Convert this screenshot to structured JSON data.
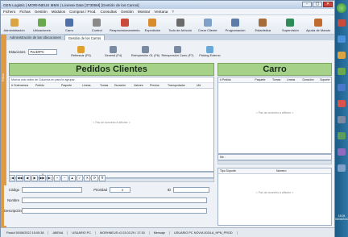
{
  "window": {
    "title": "GEN Logistic | MORHNEUS MMS | License Date [37306M] [Gestión de los Carros]",
    "controls": [
      "-",
      "▢",
      "✕"
    ]
  },
  "menu": [
    "Fichero",
    "Fichas",
    "Gestión",
    "Módulos",
    "Compras / Prod.",
    "Consultas",
    "Gestión",
    "Mostrar",
    "Ventana",
    "?"
  ],
  "toolbar": [
    {
      "label": "Administración",
      "icon": "pencil-icon",
      "color": "#d9a441"
    },
    {
      "label": "Ubicaciones",
      "icon": "box-icon",
      "color": "#6aa84f"
    },
    {
      "label": "Carro",
      "icon": "cart-icon",
      "color": "#4f6fa8"
    },
    {
      "label": "Control",
      "icon": "truck-icon",
      "color": "#8a8a8a"
    },
    {
      "label": "Reaprovisionamiento",
      "icon": "person-icon",
      "color": "#c94b3c"
    },
    {
      "label": "Expedición",
      "icon": "cube-icon",
      "color": "#d98b2b"
    },
    {
      "label": "Todo de Artículo",
      "icon": "gear-icon",
      "color": "#6b6b6b"
    },
    {
      "label": "Crear Cliente",
      "icon": "diamond-icon",
      "color": "#7fa0c8"
    },
    {
      "label": "Programación",
      "icon": "grid-icon",
      "color": "#5c7da8"
    },
    {
      "label": "Estadística",
      "icon": "chart-icon",
      "color": "#a86c3b"
    },
    {
      "label": "Supervisión",
      "icon": "monitor-icon",
      "color": "#2e8b57"
    },
    {
      "label": "Ayuda de Mando",
      "icon": "help-icon",
      "color": "#c06c2e"
    }
  ],
  "tabs": [
    "Administración de las Ubicaciones",
    "Gestión de los Carros"
  ],
  "side_label": "Filtros",
  "filter": {
    "label": "Estaciones",
    "value": "Pack#PC",
    "buttons": [
      {
        "label": "Refrescar (F5)",
        "icon": "refresh-icon",
        "color": "#e0a030"
      },
      {
        "label": "General (F4)",
        "icon": "document-icon",
        "color": "#7a8aa0"
      },
      {
        "label": "Reimpresión GL (F6)",
        "icon": "printer-icon",
        "color": "#7a8aa0"
      },
      {
        "label": "Reimpresión Carro (F7)",
        "icon": "printer-icon",
        "color": "#7a8aa0"
      },
      {
        "label": "Picking Externo",
        "icon": "box-icon",
        "color": "#6aa8d8"
      }
    ]
  },
  "pedidos": {
    "title": "Pedidos Clientes",
    "group_hint": "Mueva una orden de Columna en para le agrupar",
    "columns": [
      "# Ordenamos",
      "Pedido",
      "Paquete",
      "Líneas",
      "Tomas",
      "Duración",
      "Valores",
      "Precios",
      "Transportador",
      "Ubi"
    ],
    "empty": "< Pas de données à afficher >",
    "footer_count": "0"
  },
  "carro": {
    "title": "Carro",
    "columns": [
      "# Pedido",
      "Paquete",
      "Tomas",
      "Líneas",
      "Duración",
      "Soporte"
    ],
    "empty": "< Pas de données à afficher >",
    "footer": "Nb :"
  },
  "soporte": {
    "columns": [
      "Tipo Soporte",
      "Número"
    ],
    "empty": "< Pas de données à afficher >"
  },
  "form": {
    "codigo_label": "Código",
    "prioridad_label": "Prioridad",
    "prioridad_value": "0",
    "id_label": "ID",
    "nombre_label": "Nombre",
    "descripcion_label": "Descripción"
  },
  "nav_buttons": [
    "|◀",
    "◀◀",
    "◀",
    "▶",
    "▶▶",
    "▶|",
    "+",
    "−",
    "▲",
    "✓",
    "✕",
    "⟳",
    "∇"
  ],
  "status": [
    "Pack# 50/08/2022 15:05:38",
    "ABENA",
    "USUARIO PC",
    "MORHNEUS v2.03.03.29 / 17:30",
    "Mensaje",
    "USUARIO PC NOV/A 003/LA_HPN_PROD"
  ],
  "clock": {
    "time": "15:05",
    "date": "05/08/2022"
  },
  "taskbar_icons": [
    "#c94b3c",
    "#4a90d9",
    "#d9a441",
    "#6aa84f",
    "#4a78c8",
    "#d9534f",
    "#7a8aa0",
    "#5c9c5c",
    "#8e6bbf",
    "#7fa0c8"
  ]
}
